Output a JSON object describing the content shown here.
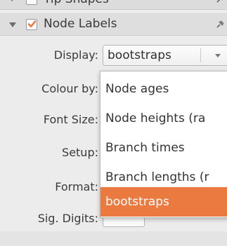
{
  "prev_section": {
    "label": "Tip Shapes",
    "checked": false
  },
  "section": {
    "label": "Node Labels",
    "checked": true,
    "accent_color": "#e8743b"
  },
  "fields": {
    "display_label": "Display:",
    "display_value": "bootstraps",
    "colour_by_label": "Colour by:",
    "font_size_label": "Font Size:",
    "setup_label": "Setup:",
    "format_label": "Format:",
    "sig_digits_label": "Sig. Digits:"
  },
  "dropdown": {
    "options": [
      "Node ages",
      "Node heights (ra",
      "Branch times",
      "Branch lengths (r",
      "bootstraps"
    ],
    "selected_index": 4,
    "highlight_color": "#ea7a3f"
  },
  "icons": {
    "expand": "triangle-right-icon",
    "collapse": "triangle-down-icon",
    "pin": "pin-icon"
  }
}
